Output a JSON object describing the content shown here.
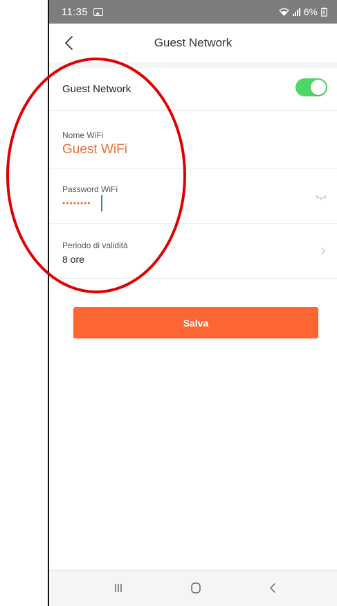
{
  "status_bar": {
    "time": "11:35",
    "battery_percent": "6%",
    "icons": [
      "gallery-icon",
      "wifi-icon",
      "signal-icon",
      "battery-icon"
    ]
  },
  "header": {
    "title": "Guest Network",
    "back_icon": "chevron-left-icon"
  },
  "guest_toggle": {
    "label": "Guest Network",
    "enabled": true,
    "color": "#4cd864"
  },
  "wifi_name": {
    "label": "Nome WiFi",
    "value": "Guest WiFi"
  },
  "wifi_password": {
    "label": "Password WiFi",
    "value": "••••••••",
    "visibility_icon": "eye-closed-icon"
  },
  "validity": {
    "label": "Periodo di validità",
    "value": "8 ore"
  },
  "save_button": {
    "label": "Salva",
    "color": "#fd6632"
  },
  "nav_bar": {
    "icons": [
      "recent-apps-icon",
      "home-icon",
      "back-icon"
    ]
  },
  "colors": {
    "accent": "#fd6632",
    "value_text": "#e8703a",
    "annotation": "#e00000"
  }
}
